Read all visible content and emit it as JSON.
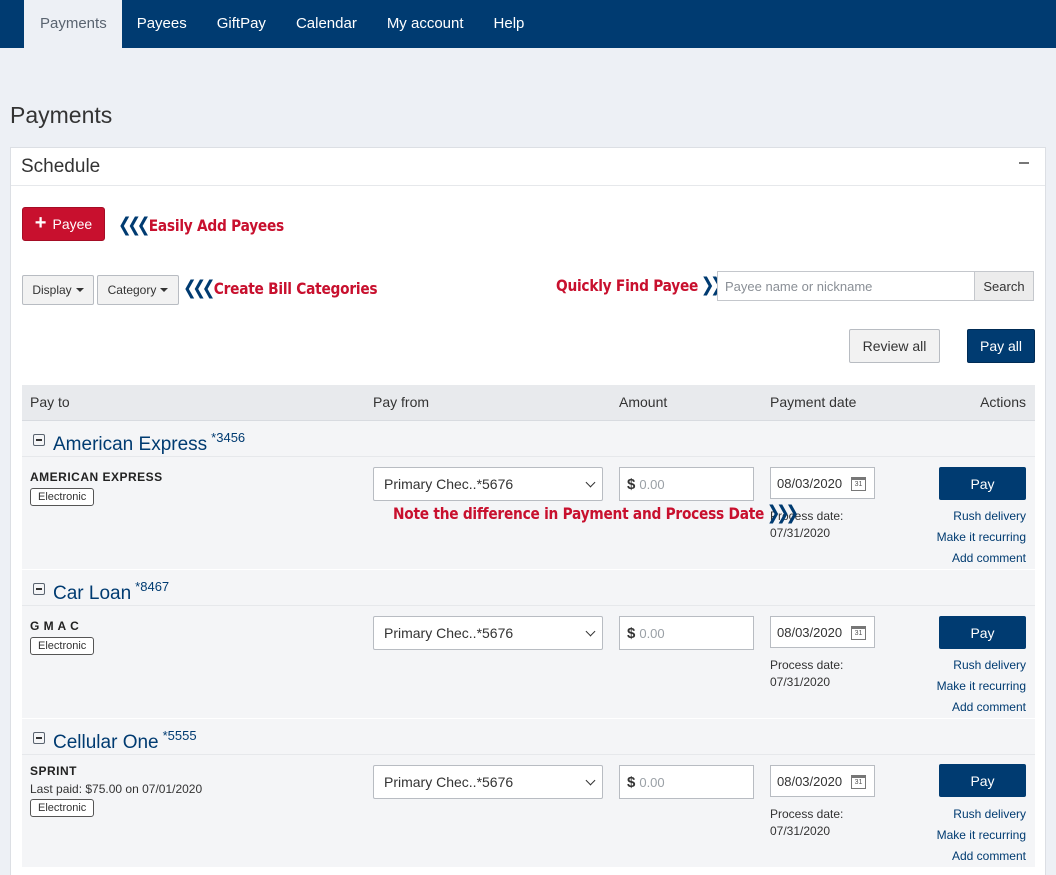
{
  "nav": [
    {
      "label": "Payments",
      "active": true
    },
    {
      "label": "Payees"
    },
    {
      "label": "GiftPay"
    },
    {
      "label": "Calendar"
    },
    {
      "label": "My account"
    },
    {
      "label": "Help"
    }
  ],
  "page_title": "Payments",
  "panel": {
    "title": "Schedule"
  },
  "add_payee": {
    "label": "Payee"
  },
  "filters": {
    "display_label": "Display",
    "category_label": "Category"
  },
  "search": {
    "placeholder": "Payee name or nickname",
    "button": "Search"
  },
  "actions": {
    "review_all": "Review all",
    "pay_all": "Pay all"
  },
  "annotations": {
    "add_payees": "Easily Add Payees",
    "bill_categories": "Create Bill Categories",
    "find_payee": "Quickly Find Payee",
    "date_difference": "Note the difference in Payment and Process Date"
  },
  "columns": {
    "pay_to": "Pay to",
    "pay_from": "Pay from",
    "amount": "Amount",
    "payment_date": "Payment date",
    "actions": "Actions"
  },
  "groups": [
    {
      "name": "American Express",
      "acct": "*3456",
      "payee": "AMERICAN EXPRESS",
      "last_paid": "",
      "badge": "Electronic",
      "pay_from": "Primary Chec..*5676",
      "currency": "$",
      "amount_placeholder": "0.00",
      "payment_date": "08/03/2020",
      "process_label": "Process date:",
      "process_date": "07/31/2020",
      "pay": "Pay",
      "rush": "Rush delivery",
      "recurring": "Make it recurring",
      "comment": "Add comment"
    },
    {
      "name": "Car Loan",
      "acct": "*8467",
      "payee": "G M A C",
      "last_paid": "",
      "badge": "Electronic",
      "pay_from": "Primary Chec..*5676",
      "currency": "$",
      "amount_placeholder": "0.00",
      "payment_date": "08/03/2020",
      "process_label": "Process date:",
      "process_date": "07/31/2020",
      "pay": "Pay",
      "rush": "Rush delivery",
      "recurring": "Make it recurring",
      "comment": "Add comment"
    },
    {
      "name": "Cellular One",
      "acct": "*5555",
      "payee": "SPRINT",
      "last_paid": "Last paid: $75.00 on 07/01/2020",
      "badge": "Electronic",
      "pay_from": "Primary Chec..*5676",
      "currency": "$",
      "amount_placeholder": "0.00",
      "payment_date": "08/03/2020",
      "process_label": "Process date:",
      "process_date": "07/31/2020",
      "pay": "Pay",
      "rush": "Rush delivery",
      "recurring": "Make it recurring",
      "comment": "Add comment"
    }
  ],
  "calendar_icon_day": "31",
  "colors": {
    "nav": "#003b71",
    "brand_red": "#c8102e",
    "link": "#003b71"
  }
}
